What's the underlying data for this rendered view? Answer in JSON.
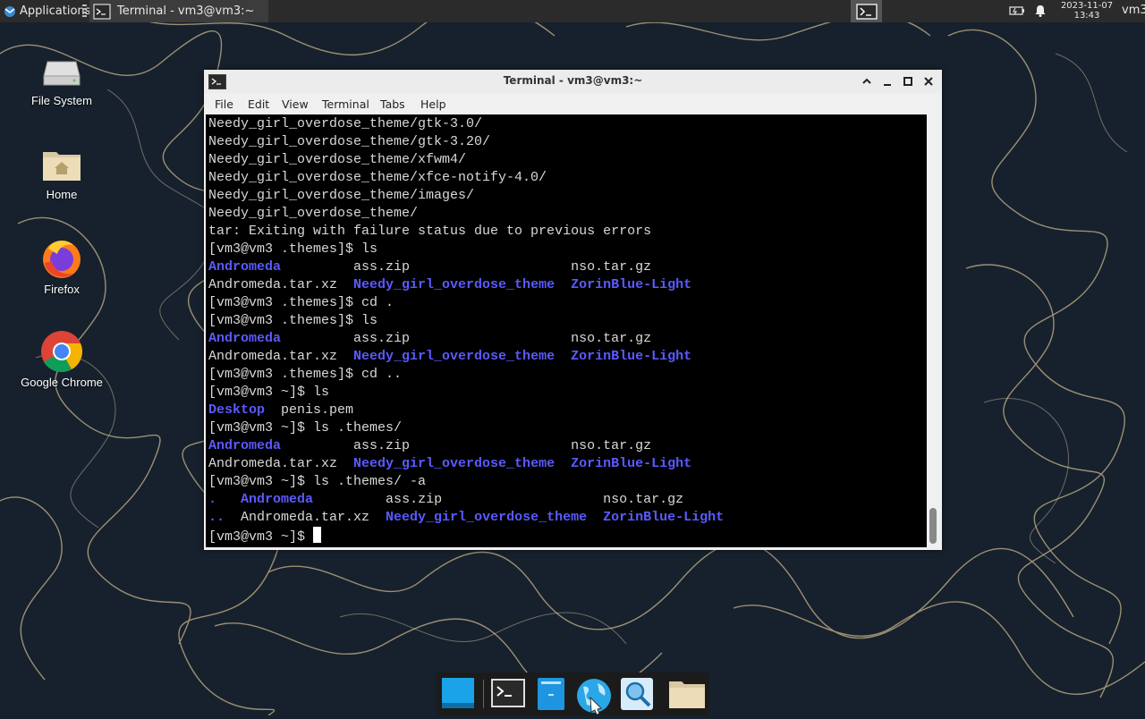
{
  "top_panel": {
    "applications_label": "Applications",
    "window_button_label": "Terminal - vm3@vm3:~",
    "clock_date": "2023-11-07",
    "clock_time": "13:43",
    "user": "vm3"
  },
  "desktop_icons": [
    {
      "label": "File System",
      "icon": "drive-icon"
    },
    {
      "label": "Home",
      "icon": "home-folder-icon"
    },
    {
      "label": "Firefox",
      "icon": "firefox-icon"
    },
    {
      "label": "Google Chrome",
      "icon": "chrome-icon"
    }
  ],
  "window": {
    "title": "Terminal - vm3@vm3:~",
    "menu": [
      "File",
      "Edit",
      "View",
      "Terminal",
      "Tabs",
      "Help"
    ]
  },
  "terminal_lines": [
    [
      {
        "t": "Needy_girl_overdose_theme/gtk-3.0/"
      }
    ],
    [
      {
        "t": "Needy_girl_overdose_theme/gtk-3.20/"
      }
    ],
    [
      {
        "t": "Needy_girl_overdose_theme/xfwm4/"
      }
    ],
    [
      {
        "t": "Needy_girl_overdose_theme/xfce-notify-4.0/"
      }
    ],
    [
      {
        "t": "Needy_girl_overdose_theme/images/"
      }
    ],
    [
      {
        "t": "Needy_girl_overdose_theme/"
      }
    ],
    [
      {
        "t": "tar: Exiting with failure status due to previous errors"
      }
    ],
    [
      {
        "t": "[vm3@vm3 .themes]$ ls"
      }
    ],
    [
      {
        "t": "Andromeda",
        "d": true
      },
      {
        "t": "         ass.zip                    nso.tar.gz"
      }
    ],
    [
      {
        "t": "Andromeda.tar.xz  "
      },
      {
        "t": "Needy_girl_overdose_theme",
        "d": true
      },
      {
        "t": "  "
      },
      {
        "t": "ZorinBlue-Light",
        "d": true
      }
    ],
    [
      {
        "t": "[vm3@vm3 .themes]$ cd ."
      }
    ],
    [
      {
        "t": "[vm3@vm3 .themes]$ ls"
      }
    ],
    [
      {
        "t": "Andromeda",
        "d": true
      },
      {
        "t": "         ass.zip                    nso.tar.gz"
      }
    ],
    [
      {
        "t": "Andromeda.tar.xz  "
      },
      {
        "t": "Needy_girl_overdose_theme",
        "d": true
      },
      {
        "t": "  "
      },
      {
        "t": "ZorinBlue-Light",
        "d": true
      }
    ],
    [
      {
        "t": "[vm3@vm3 .themes]$ cd .."
      }
    ],
    [
      {
        "t": "[vm3@vm3 ~]$ ls"
      }
    ],
    [
      {
        "t": "Desktop",
        "d": true
      },
      {
        "t": "  penis.pem"
      }
    ],
    [
      {
        "t": "[vm3@vm3 ~]$ ls .themes/"
      }
    ],
    [
      {
        "t": "Andromeda",
        "d": true
      },
      {
        "t": "         ass.zip                    nso.tar.gz"
      }
    ],
    [
      {
        "t": "Andromeda.tar.xz  "
      },
      {
        "t": "Needy_girl_overdose_theme",
        "d": true
      },
      {
        "t": "  "
      },
      {
        "t": "ZorinBlue-Light",
        "d": true
      }
    ],
    [
      {
        "t": "[vm3@vm3 ~]$ ls .themes/ -a"
      }
    ],
    [
      {
        "t": ".",
        "d": true
      },
      {
        "t": "   "
      },
      {
        "t": "Andromeda",
        "d": true
      },
      {
        "t": "         ass.zip                    nso.tar.gz"
      }
    ],
    [
      {
        "t": "..",
        "d": true
      },
      {
        "t": "  Andromeda.tar.xz  "
      },
      {
        "t": "Needy_girl_overdose_theme",
        "d": true
      },
      {
        "t": "  "
      },
      {
        "t": "ZorinBlue-Light",
        "d": true
      }
    ],
    [
      {
        "t": "[vm3@vm3 ~]$ "
      },
      {
        "cursor": true
      }
    ]
  ],
  "dock": [
    {
      "name": "show-desktop-icon"
    },
    {
      "name": "terminal-icon"
    },
    {
      "name": "file-manager-icon"
    },
    {
      "name": "web-browser-icon"
    },
    {
      "name": "app-finder-icon"
    },
    {
      "name": "folder-icon"
    }
  ],
  "colors": {
    "directory": "#5a5aff",
    "terminal_bg": "#000000",
    "terminal_fg": "#d8d8d8"
  }
}
